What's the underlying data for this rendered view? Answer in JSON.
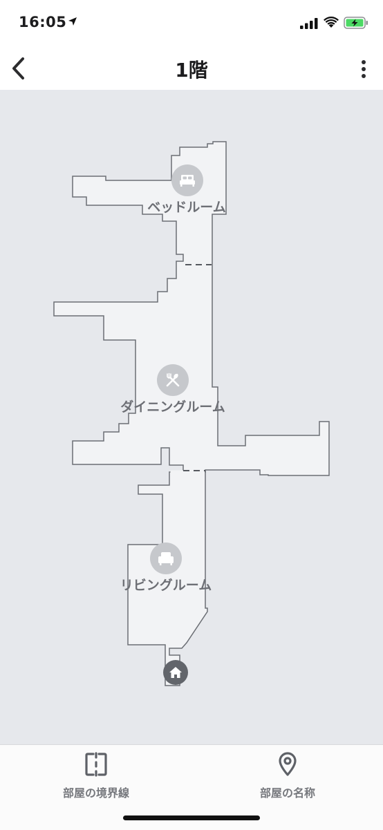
{
  "status_bar": {
    "time": "16:05"
  },
  "nav": {
    "title": "1階",
    "back_icon": "chevron-left-icon",
    "more_icon": "more-vertical-icon"
  },
  "map": {
    "colors": {
      "background": "#e6e8ec",
      "floor": "#f2f3f5",
      "wall": "#6b6e74",
      "icon_bg": "#c6c8cc",
      "label": "#6d6f75",
      "dock": "#62656b"
    },
    "rooms": [
      {
        "name": "ベッドルーム",
        "icon": "bed-icon"
      },
      {
        "name": "ダイニングルーム",
        "icon": "fork-knife-icon"
      },
      {
        "name": "リビングルーム",
        "icon": "armchair-icon"
      }
    ],
    "dock_icon": "home-icon"
  },
  "toolbar": {
    "boundary_label": "部屋の境界線",
    "boundary_icon": "split-boundary-icon",
    "name_label": "部屋の名称",
    "name_icon": "location-pin-icon"
  }
}
